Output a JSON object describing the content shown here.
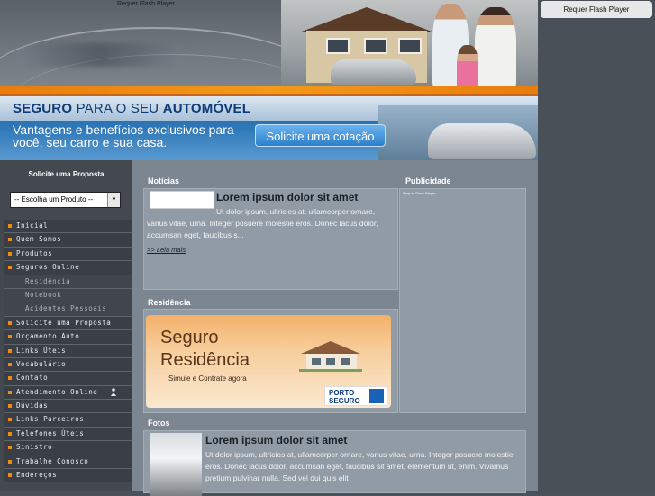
{
  "header": {
    "flash_label": "Requer Flash Player"
  },
  "right_column": {
    "flash_button": "Requer Flash Player"
  },
  "banner": {
    "title_bold_1": "SEGURO",
    "title_light": " PARA O SEU ",
    "title_bold_2": "AUTOMÓVEL",
    "subtitle": "Vantagens e benefícios exclusivos para você, seu carro e sua casa.",
    "cta": "Solicite uma cotação"
  },
  "sidebar": {
    "proposal_title": "Solicite uma Proposta",
    "product_select": "-- Escolha um Produto --",
    "menu": [
      {
        "label": "Inicial",
        "sub": false
      },
      {
        "label": "Quem Somos",
        "sub": false
      },
      {
        "label": "Produtos",
        "sub": false
      },
      {
        "label": "Seguros Online",
        "sub": false
      },
      {
        "label": "Residência",
        "sub": true
      },
      {
        "label": "Notebook",
        "sub": true
      },
      {
        "label": "Acidentes Pessoais",
        "sub": true
      },
      {
        "label": "Solicite uma Proposta",
        "sub": false
      },
      {
        "label": "Orçamento Auto",
        "sub": false
      },
      {
        "label": "Links Úteis",
        "sub": false
      },
      {
        "label": "Vocabulário",
        "sub": false
      },
      {
        "label": "Contato",
        "sub": false
      },
      {
        "label": "Atendimento Online",
        "sub": false
      },
      {
        "label": "Dúvidas",
        "sub": false
      },
      {
        "label": "Links Parceiros",
        "sub": false
      },
      {
        "label": "Telefones Úteis",
        "sub": false
      },
      {
        "label": "Sinistro",
        "sub": false
      },
      {
        "label": "Trabalhe Conosco",
        "sub": false
      },
      {
        "label": "Endereços",
        "sub": false
      }
    ]
  },
  "news": {
    "title": "Notícias",
    "headline": "Lorem ipsum dolor sit amet",
    "body": "Ut dolor ipsum, ultricies at, ullamcorper ornare, varius vitae, urna. Integer posuere molestie eros. Donec lacus dolor, accumsan eget, faucibus s...",
    "more": ">> Leia mais"
  },
  "ads": {
    "title": "Publicidade",
    "flash_label": "Requer Flash Player"
  },
  "residence": {
    "title": "Residência",
    "line1": "Seguro",
    "line2": "Residência",
    "line3": "Simule e Contrate agora",
    "logo1": "PORTO",
    "logo2": "SEGURO"
  },
  "photos": {
    "title": "Fotos",
    "headline": "Lorem ipsum dolor sit amet",
    "body": "Ut dolor ipsum, ultricies at, ullamcorper ornare, varius vitae, urna. Integer posuere molestie eros. Donec lacus dolor, accumsan eget, faucibus sit amet, elementum ut, enim. Vivamus pretium pulvinar nulla. Sed vel dui quis elit"
  }
}
